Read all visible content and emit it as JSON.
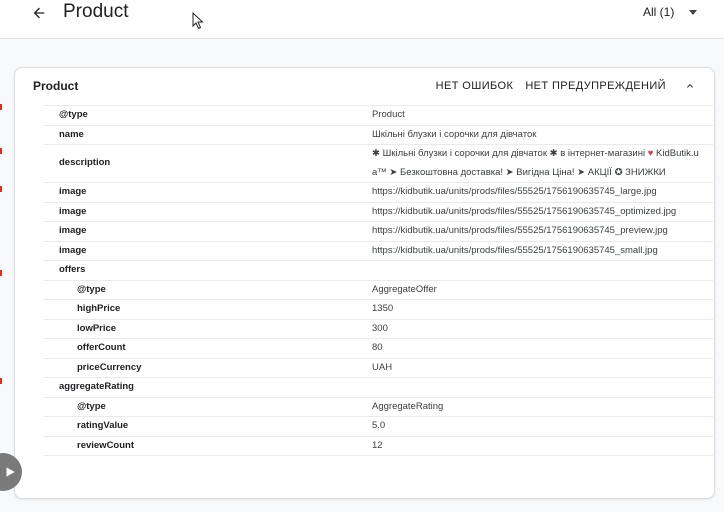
{
  "header": {
    "title": "Product",
    "filter_label": "All (1)"
  },
  "card": {
    "title": "Product",
    "no_errors": "НЕТ ОШИБОК",
    "no_warnings": "НЕТ ПРЕДУПРЕЖДЕНИЙ"
  },
  "rows": [
    {
      "key": "@type",
      "value": "Product"
    },
    {
      "key": "name",
      "value": "Шкільні блузки і сорочки для дівчаток"
    },
    {
      "key": "description",
      "value_pre": "✱ Шкільні блузки і сорочки для дівчаток ✱ в інтернет-магазині",
      "value_heart": "♥",
      "value_post": " KidButik.ua™ ➤ Безкоштовна доставка! ➤ Вигідна Ціна! ➤ АКЦІЇ ✪ ЗНИЖКИ"
    },
    {
      "key": "image",
      "value": "https://kidbutik.ua/units/prods/files/55525/1756190635745_large.jpg"
    },
    {
      "key": "image",
      "value": "https://kidbutik.ua/units/prods/files/55525/1756190635745_optimized.jpg"
    },
    {
      "key": "image",
      "value": "https://kidbutik.ua/units/prods/files/55525/1756190635745_preview.jpg"
    },
    {
      "key": "image",
      "value": "https://kidbutik.ua/units/prods/files/55525/1756190635745_small.jpg"
    },
    {
      "key": "offers",
      "value": ""
    },
    {
      "key": "@type",
      "value": "AggregateOffer"
    },
    {
      "key": "highPrice",
      "value": "1350"
    },
    {
      "key": "lowPrice",
      "value": "300"
    },
    {
      "key": "offerCount",
      "value": "80"
    },
    {
      "key": "priceCurrency",
      "value": "UAH"
    },
    {
      "key": "aggregateRating",
      "value": ""
    },
    {
      "key": "@type",
      "value": "AggregateRating"
    },
    {
      "key": "ratingValue",
      "value": "5.0"
    },
    {
      "key": "reviewCount",
      "value": "12"
    }
  ],
  "icons": {
    "back": "arrow-back-icon",
    "caret": "chevron-down-icon",
    "collapse": "chevron-up-icon",
    "fab": "play-icon",
    "cursor": "mouse-cursor-icon"
  }
}
